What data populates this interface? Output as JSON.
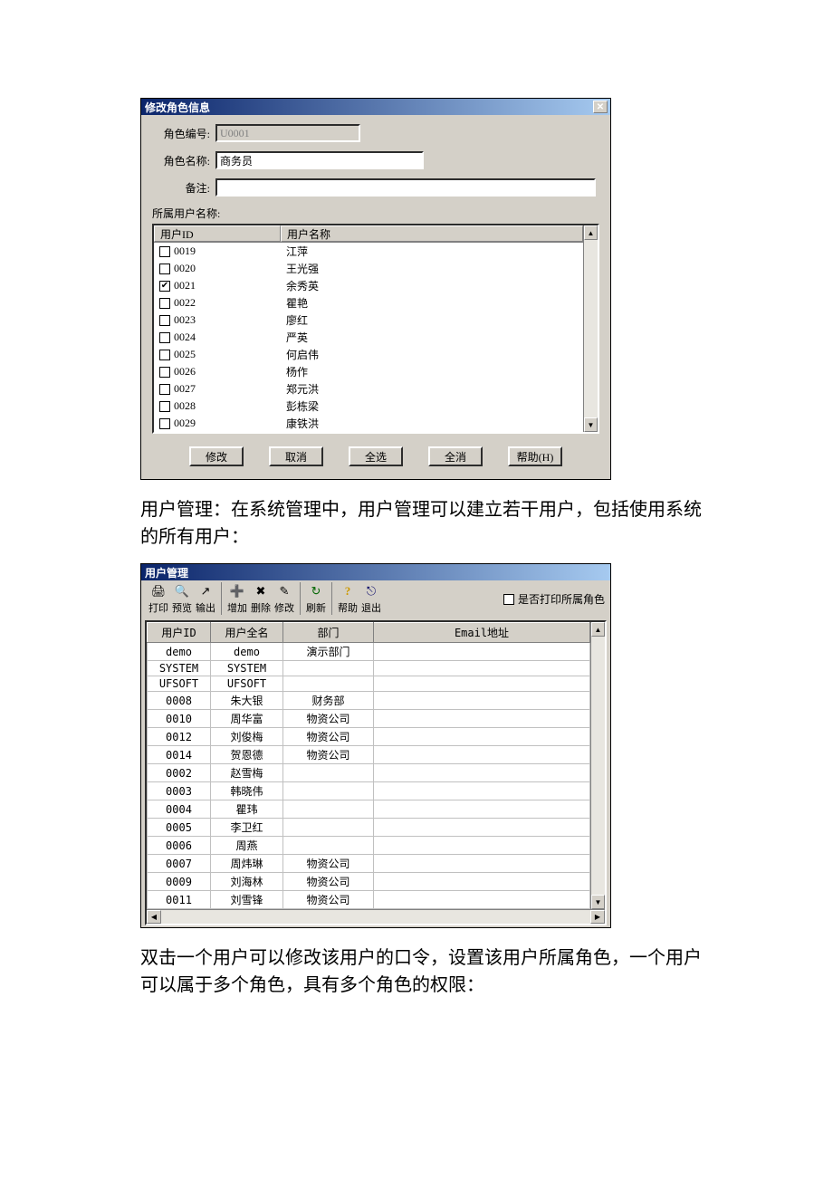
{
  "dialog1": {
    "title": "修改角色信息",
    "labels": {
      "role_id": "角色编号:",
      "role_name": "角色名称:",
      "remark": "备注:",
      "users_section": "所属用户名称:"
    },
    "values": {
      "role_id": "U0001",
      "role_name": "商务员",
      "remark": ""
    },
    "user_list_headers": {
      "id": "用户ID",
      "name": "用户名称"
    },
    "user_list": [
      {
        "id": "0019",
        "name": "江萍",
        "checked": false
      },
      {
        "id": "0020",
        "name": "王光强",
        "checked": false
      },
      {
        "id": "0021",
        "name": "余秀英",
        "checked": true
      },
      {
        "id": "0022",
        "name": "瞿艳",
        "checked": false
      },
      {
        "id": "0023",
        "name": "廖红",
        "checked": false
      },
      {
        "id": "0024",
        "name": "严英",
        "checked": false
      },
      {
        "id": "0025",
        "name": "何启伟",
        "checked": false
      },
      {
        "id": "0026",
        "name": "杨作",
        "checked": false
      },
      {
        "id": "0027",
        "name": "郑元洪",
        "checked": false
      },
      {
        "id": "0028",
        "name": "彭栋梁",
        "checked": false
      },
      {
        "id": "0029",
        "name": "康铁洪",
        "checked": false
      }
    ],
    "buttons": {
      "modify": "修改",
      "cancel": "取消",
      "select_all": "全选",
      "deselect_all": "全消",
      "help": "帮助(H)"
    }
  },
  "paragraph1": "用户管理：在系统管理中，用户管理可以建立若干用户，包括使用系统的所有用户：",
  "dialog2": {
    "title": "用户管理",
    "toolbar": {
      "print": "打印",
      "preview": "预览",
      "export": "输出",
      "add": "增加",
      "delete": "删除",
      "modify": "修改",
      "refresh": "刷新",
      "help": "帮助",
      "exit": "退出",
      "print_role_checkbox": "是否打印所属角色"
    },
    "grid_headers": {
      "id": "用户ID",
      "fullname": "用户全名",
      "dept": "部门",
      "email": "Email地址"
    },
    "grid_rows": [
      {
        "id": "demo",
        "fullname": "demo",
        "dept": "演示部门",
        "email": ""
      },
      {
        "id": "SYSTEM",
        "fullname": "SYSTEM",
        "dept": "",
        "email": ""
      },
      {
        "id": "UFSOFT",
        "fullname": "UFSOFT",
        "dept": "",
        "email": ""
      },
      {
        "id": "0008",
        "fullname": "朱大银",
        "dept": "财务部",
        "email": ""
      },
      {
        "id": "0010",
        "fullname": "周华富",
        "dept": "物资公司",
        "email": ""
      },
      {
        "id": "0012",
        "fullname": "刘俊梅",
        "dept": "物资公司",
        "email": ""
      },
      {
        "id": "0014",
        "fullname": "贺恩德",
        "dept": "物资公司",
        "email": ""
      },
      {
        "id": "0002",
        "fullname": "赵雪梅",
        "dept": "",
        "email": ""
      },
      {
        "id": "0003",
        "fullname": "韩晓伟",
        "dept": "",
        "email": ""
      },
      {
        "id": "0004",
        "fullname": "瞿玮",
        "dept": "",
        "email": ""
      },
      {
        "id": "0005",
        "fullname": "李卫红",
        "dept": "",
        "email": ""
      },
      {
        "id": "0006",
        "fullname": "周燕",
        "dept": "",
        "email": ""
      },
      {
        "id": "0007",
        "fullname": "周炜琳",
        "dept": "物资公司",
        "email": ""
      },
      {
        "id": "0009",
        "fullname": "刘海林",
        "dept": "物资公司",
        "email": ""
      },
      {
        "id": "0011",
        "fullname": "刘雪锋",
        "dept": "物资公司",
        "email": ""
      }
    ]
  },
  "paragraph2": "双击一个用户可以修改该用户的口令，设置该用户所属角色，一个用户可以属于多个角色，具有多个角色的权限：",
  "glyphs": {
    "close": "✕",
    "up": "▲",
    "down": "▼",
    "left": "◀",
    "right": "▶",
    "check": "✔",
    "print": "🖨",
    "preview": "🔍",
    "export": "↗",
    "add": "➕",
    "delete": "✖",
    "modify": "✎",
    "refresh": "↻",
    "help": "?",
    "exit": "⎋"
  }
}
